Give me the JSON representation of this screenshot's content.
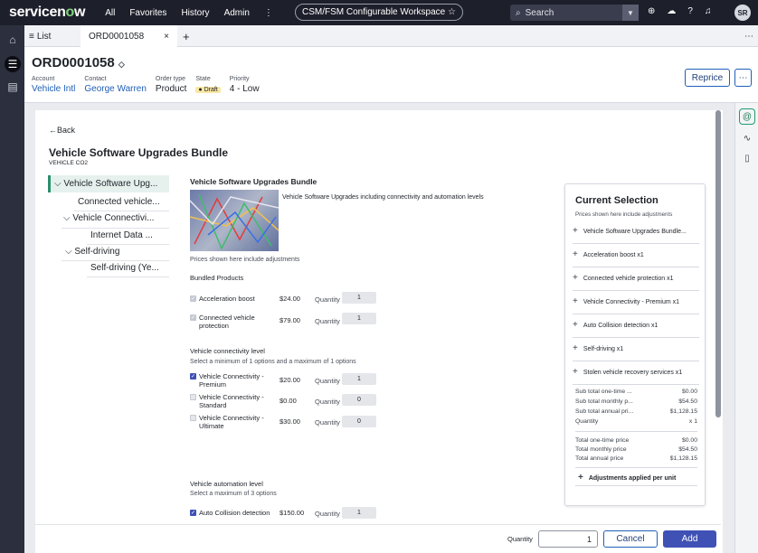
{
  "topbar": {
    "logo_prefix": "servicen",
    "logo_o": "o",
    "logo_suffix": "w",
    "nav": [
      "All",
      "Favorites",
      "History",
      "Admin",
      "⋮"
    ],
    "workspace": "CSM/FSM Configurable Workspace",
    "workspace_star": "☆",
    "search_placeholder": "Search",
    "avatar": "SR"
  },
  "tabs": {
    "list": "List",
    "record": "ORD0001058",
    "close": "×",
    "add": "+",
    "more": "⋯"
  },
  "record": {
    "number": "ORD0001058",
    "fields": [
      {
        "label": "Account",
        "value": "Vehicle Intl"
      },
      {
        "label": "Contact",
        "value": "George Warren"
      },
      {
        "label": "Order type",
        "value": "Product"
      },
      {
        "label": "State",
        "value": "Draft"
      },
      {
        "label": "Priority",
        "value": "4 - Low"
      }
    ],
    "reprice": "Reprice",
    "more": "⋯"
  },
  "config": {
    "back": "Back",
    "title": "Vehicle Software Upgrades Bundle",
    "subtitle": "VEHICLE CO2",
    "tree": [
      "Vehicle Software Upg...",
      "Connected vehicle...",
      "Vehicle Connectivi...",
      "Internet Data ...",
      "Self-driving",
      "Self-driving (Ye..."
    ],
    "bundle_title": "Vehicle Software Upgrades Bundle",
    "bundle_desc": "Vehicle Software Upgrades including connectivity and automation levels",
    "prices_note": "Prices shown here include adjustments",
    "bundled_label": "Bundled Products",
    "quantity_label": "Quantity",
    "bundled": [
      {
        "name": "Acceleration boost",
        "price": "$24.00",
        "qty": "1"
      },
      {
        "name": "Connected vehicle protection",
        "price": "$79.00",
        "qty": "1"
      }
    ],
    "connectivity_title": "Vehicle connectivity level",
    "connectivity_hint": "Select a minimum of 1 options and a maximum of 1 options",
    "connectivity": [
      {
        "name": "Vehicle Connectivity - Premium",
        "price": "$20.00",
        "qty": "1",
        "checked": true
      },
      {
        "name": "Vehicle Connectivity - Standard",
        "price": "$0.00",
        "qty": "0",
        "checked": false
      },
      {
        "name": "Vehicle Connectivity - Ultimate",
        "price": "$30.00",
        "qty": "0",
        "checked": false
      }
    ],
    "automation_title": "Vehicle automation level",
    "automation_hint": "Select a maximum of 3 options",
    "automation": [
      {
        "name": "Auto Collision detection",
        "price": "$150.00",
        "qty": "1",
        "checked": true
      }
    ]
  },
  "selection": {
    "title": "Current Selection",
    "note": "Prices shown here include adjustments",
    "items": [
      "Vehicle Software Upgrades Bundle...",
      "Acceleration boost x1",
      "Connected vehicle protection x1",
      "Vehicle Connectivity - Premium x1",
      "Auto Collision detection x1",
      "Self-driving x1",
      "Stolen vehicle recovery services x1"
    ],
    "subtotals": [
      {
        "label": "Sub total one-time ...",
        "value": "$0.00"
      },
      {
        "label": "Sub total monthly p...",
        "value": "$54.50"
      },
      {
        "label": "Sub total annual pri...",
        "value": "$1,128.15"
      },
      {
        "label": "Quantity",
        "value": "x 1"
      }
    ],
    "totals": [
      {
        "label": "Total one-time price",
        "value": "$0.00"
      },
      {
        "label": "Total monthly price",
        "value": "$54.50"
      },
      {
        "label": "Total annual price",
        "value": "$1,128.15"
      }
    ],
    "adjustments": "Adjustments applied per unit"
  },
  "footer": {
    "quantity_label": "Quantity",
    "quantity": "1",
    "cancel": "Cancel",
    "add": "Add"
  },
  "colors": {
    "accent": "#3f51b5",
    "green": "#2a8f6a",
    "draft": "#fbe7a4"
  }
}
